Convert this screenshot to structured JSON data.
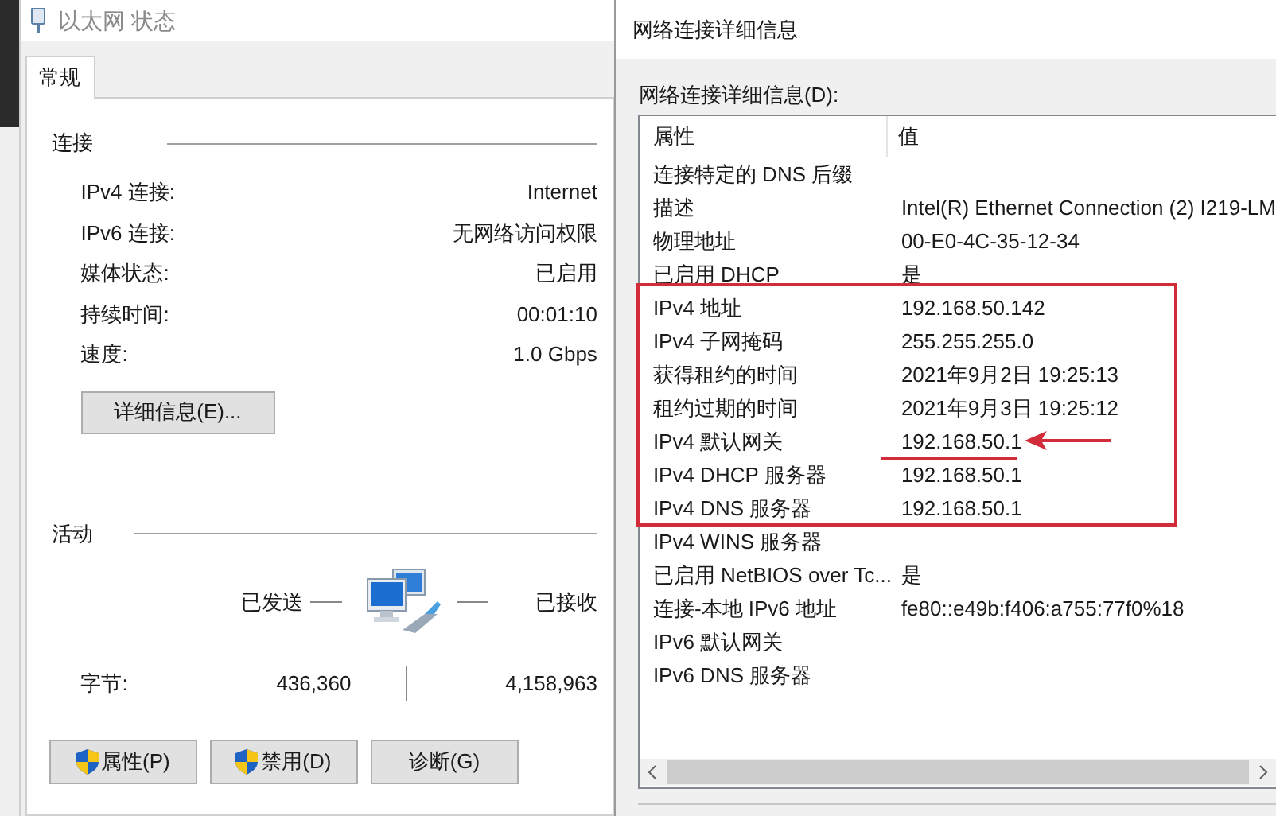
{
  "status_window": {
    "title": "以太网 状态",
    "tabs": [
      {
        "label": "常规",
        "selected": true
      }
    ],
    "connection": {
      "heading": "连接",
      "rows": [
        {
          "label": "IPv4 连接:",
          "value": "Internet"
        },
        {
          "label": "IPv6 连接:",
          "value": "无网络访问权限"
        },
        {
          "label": "媒体状态:",
          "value": "已启用"
        },
        {
          "label": "持续时间:",
          "value": "00:01:10"
        },
        {
          "label": "速度:",
          "value": "1.0 Gbps"
        }
      ],
      "details_button": "详细信息(E)..."
    },
    "activity": {
      "heading": "活动",
      "sent_label": "已发送",
      "received_label": "已接收",
      "bytes_label": "字节:",
      "bytes_sent": "436,360",
      "bytes_received": "4,158,963"
    },
    "buttons": [
      {
        "label": "属性(P)",
        "shield": true
      },
      {
        "label": "禁用(D)",
        "shield": true
      },
      {
        "label": "诊断(G)",
        "shield": false
      }
    ]
  },
  "details_window": {
    "title": "网络连接详细信息",
    "list_label": "网络连接详细信息(D):",
    "columns": [
      "属性",
      "值"
    ],
    "rows": [
      {
        "property": "连接特定的 DNS 后缀"
      },
      {
        "property": "描述",
        "value": "Intel(R) Ethernet Connection (2) I219-LM"
      },
      {
        "property": "物理地址",
        "value": "00-E0-4C-35-12-34"
      },
      {
        "property": "已启用 DHCP",
        "value": "是"
      },
      {
        "property": "IPv4 地址",
        "value": "192.168.50.142"
      },
      {
        "property": "IPv4 子网掩码",
        "value": "255.255.255.0"
      },
      {
        "property": "获得租约的时间",
        "value": "2021年9月2日 19:25:13"
      },
      {
        "property": "租约过期的时间",
        "value": "2021年9月3日 19:25:12"
      },
      {
        "property": "IPv4 默认网关",
        "value": "192.168.50.1"
      },
      {
        "property": "IPv4 DHCP 服务器",
        "value": "192.168.50.1"
      },
      {
        "property": "IPv4 DNS 服务器",
        "value": "192.168.50.1"
      },
      {
        "property": "IPv4 WINS 服务器"
      },
      {
        "property": "已启用 NetBIOS over Tc...",
        "value": "是"
      },
      {
        "property": "连接-本地 IPv6 地址",
        "value": "fe80::e49b:f406:a755:77f0%18"
      },
      {
        "property": "IPv6 默认网关"
      },
      {
        "property": "IPv6 DNS 服务器"
      }
    ]
  }
}
